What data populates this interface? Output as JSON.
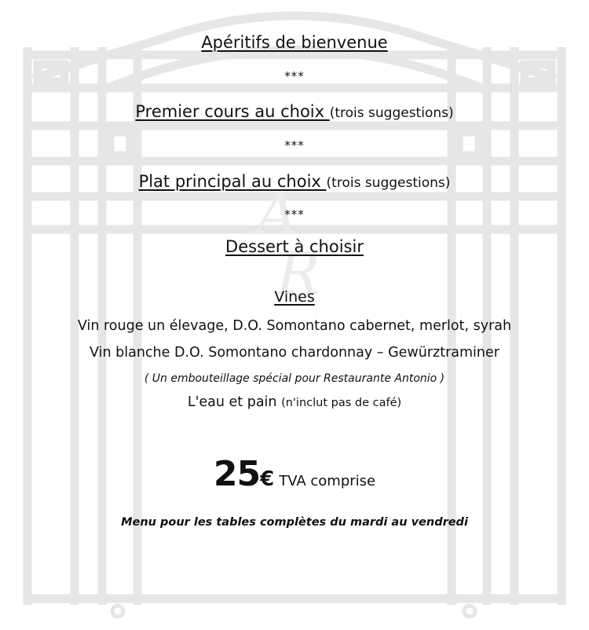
{
  "menu": {
    "aperitifs": "Apéritifs de bienvenue",
    "sep1": "***",
    "first_course": "Premier cours au choix ",
    "first_course_note": "(trois suggestions)",
    "sep2": "***",
    "main_course": "Plat principal au choix ",
    "main_course_note": "(trois suggestions)",
    "sep3": "***",
    "dessert": "Dessert à choisir"
  },
  "wines": {
    "heading": "Vines",
    "red": "Vin rouge un élevage, D.O. Somontano cabernet, merlot, syrah",
    "white": "Vin blanche D.O. Somontano chardonnay – Gewürztraminer",
    "bottling_note": "( Un embouteillage spécial pour Restaurante Antonio )",
    "water_bread": "L'eau et pain ",
    "coffee_note": "(n'inclut pas de café)"
  },
  "price": {
    "amount": "25",
    "currency": "€",
    "tax_note": "TVA comprise"
  },
  "footer": "Menu pour les tables complètes du mardi au vendredi",
  "watermark": {
    "monogram_top": "A",
    "monogram_bottom": "R",
    "color": "#e6e6e6"
  }
}
